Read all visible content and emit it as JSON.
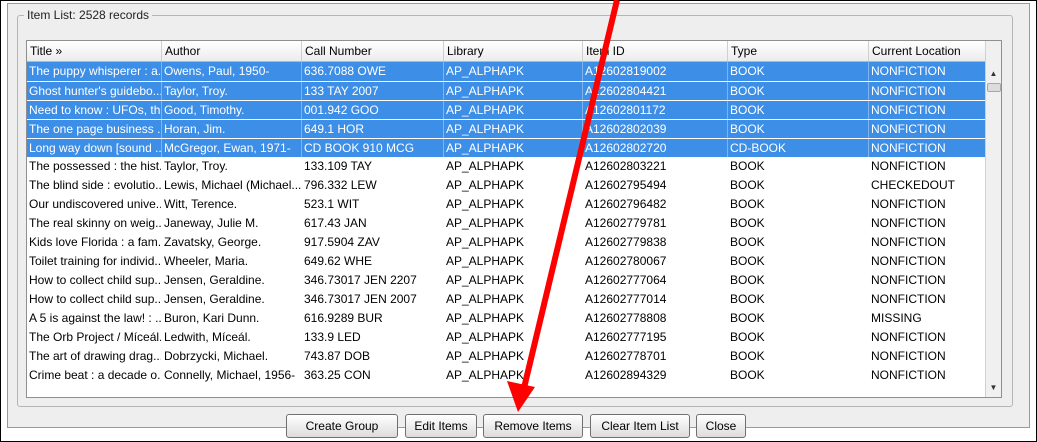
{
  "window": {
    "group_title": "Item List: 2528 records"
  },
  "table": {
    "columns": [
      "Title »",
      "Author",
      "Call Number",
      "Library",
      "Item ID",
      "Type",
      "Current Location"
    ],
    "rows": [
      {
        "selected": true,
        "cells": [
          "The puppy whisperer : a...",
          "Owens, Paul, 1950-",
          "636.7088 OWE",
          "AP_ALPHAPK",
          "A12602819002",
          "BOOK",
          "NONFICTION"
        ]
      },
      {
        "selected": true,
        "cells": [
          "Ghost hunter's guidebo...",
          "Taylor, Troy.",
          "133 TAY 2007",
          "AP_ALPHAPK",
          "A12602804421",
          "BOOK",
          "NONFICTION"
        ]
      },
      {
        "selected": true,
        "cells": [
          "Need to know : UFOs, th...",
          "Good, Timothy.",
          "001.942 GOO",
          "AP_ALPHAPK",
          "A12602801172",
          "BOOK",
          "NONFICTION"
        ]
      },
      {
        "selected": true,
        "cells": [
          "The one page business ...",
          "Horan, Jim.",
          "649.1 HOR",
          "AP_ALPHAPK",
          "A12602802039",
          "BOOK",
          "NONFICTION"
        ]
      },
      {
        "selected": true,
        "cells": [
          "Long way down [sound ...",
          "McGregor, Ewan, 1971-",
          "CD BOOK 910 MCG",
          "AP_ALPHAPK",
          "A12602802720",
          "CD-BOOK",
          "NONFICTION"
        ]
      },
      {
        "selected": false,
        "cells": [
          "The possessed : the hist...",
          "Taylor, Troy.",
          "133.109 TAY",
          "AP_ALPHAPK",
          "A12602803221",
          "BOOK",
          "NONFICTION"
        ]
      },
      {
        "selected": false,
        "cells": [
          "The blind side : evolutio...",
          "Lewis, Michael (Michael...",
          "796.332 LEW",
          "AP_ALPHAPK",
          "A12602795494",
          "BOOK",
          "CHECKEDOUT"
        ]
      },
      {
        "selected": false,
        "cells": [
          "Our undiscovered unive...",
          "Witt, Terence.",
          "523.1 WIT",
          "AP_ALPHAPK",
          "A12602796482",
          "BOOK",
          "NONFICTION"
        ]
      },
      {
        "selected": false,
        "cells": [
          "The real skinny on weig...",
          "Janeway, Julie M.",
          "617.43 JAN",
          "AP_ALPHAPK",
          "A12602779781",
          "BOOK",
          "NONFICTION"
        ]
      },
      {
        "selected": false,
        "cells": [
          "Kids love Florida : a fam...",
          "Zavatsky, George.",
          "917.5904 ZAV",
          "AP_ALPHAPK",
          "A12602779838",
          "BOOK",
          "NONFICTION"
        ]
      },
      {
        "selected": false,
        "cells": [
          "Toilet training for individ...",
          "Wheeler, Maria.",
          "649.62 WHE",
          "AP_ALPHAPK",
          "A12602780067",
          "BOOK",
          "NONFICTION"
        ]
      },
      {
        "selected": false,
        "cells": [
          "How to collect child sup...",
          "Jensen, Geraldine.",
          "346.73017 JEN 2207",
          "AP_ALPHAPK",
          "A12602777064",
          "BOOK",
          "NONFICTION"
        ]
      },
      {
        "selected": false,
        "cells": [
          "How to collect child sup...",
          "Jensen, Geraldine.",
          "346.73017 JEN 2007",
          "AP_ALPHAPK",
          "A12602777014",
          "BOOK",
          "NONFICTION"
        ]
      },
      {
        "selected": false,
        "cells": [
          "A 5 is against the law! : ...",
          "Buron, Kari Dunn.",
          "616.9289 BUR",
          "AP_ALPHAPK",
          "A12602778808",
          "BOOK",
          "MISSING"
        ]
      },
      {
        "selected": false,
        "cells": [
          "The Orb Project / Míceál...",
          "Ledwith, Míceál.",
          "133.9 LED",
          "AP_ALPHAPK",
          "A12602777195",
          "BOOK",
          "NONFICTION"
        ]
      },
      {
        "selected": false,
        "cells": [
          "The art of drawing drag...",
          "Dobrzycki, Michael.",
          "743.87 DOB",
          "AP_ALPHAPK",
          "A12602778701",
          "BOOK",
          "NONFICTION"
        ]
      },
      {
        "selected": false,
        "cells": [
          "Crime beat : a decade o...",
          "Connelly, Michael, 1956-",
          "363.25 CON",
          "AP_ALPHAPK",
          "A12602894329",
          "BOOK",
          "NONFICTION"
        ]
      }
    ]
  },
  "buttons": {
    "create_group": "Create Group",
    "edit_items": "Edit Items",
    "remove_items": "Remove Items",
    "clear_item_list": "Clear Item List",
    "close": "Close"
  },
  "colors": {
    "selection": "#3d8ee6",
    "annotation_arrow": "#ff0000"
  }
}
